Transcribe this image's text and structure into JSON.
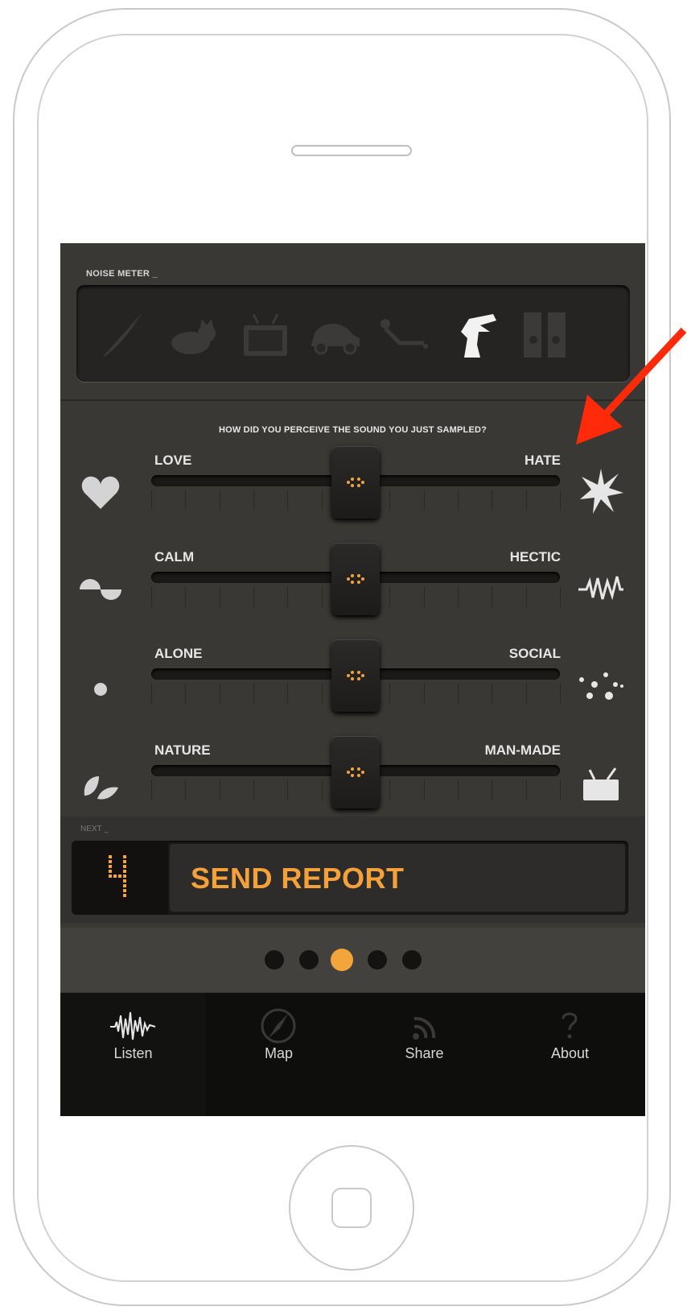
{
  "noise_meter": {
    "label": "NOISE METER _"
  },
  "perception": {
    "question": "HOW DID YOU PERCEIVE THE SOUND YOU JUST SAMPLED?",
    "sliders": [
      {
        "left": "LOVE",
        "right": "HATE",
        "value": 0.5
      },
      {
        "left": "CALM",
        "right": "HECTIC",
        "value": 0.5
      },
      {
        "left": "ALONE",
        "right": "SOCIAL",
        "value": 0.5
      },
      {
        "left": "NATURE",
        "right": "MAN-MADE",
        "value": 0.5
      }
    ]
  },
  "next": {
    "label": "NEXT _",
    "step": "4",
    "button": "SEND REPORT"
  },
  "pager": {
    "total": 5,
    "active": 3
  },
  "tabs": [
    {
      "label": "Listen",
      "icon": "waveform-icon"
    },
    {
      "label": "Map",
      "icon": "compass-icon"
    },
    {
      "label": "Share",
      "icon": "rss-icon"
    },
    {
      "label": "About",
      "icon": "question-icon"
    }
  ],
  "colors": {
    "accent": "#f3a43a",
    "annotation_arrow": "#ff2a0a"
  }
}
